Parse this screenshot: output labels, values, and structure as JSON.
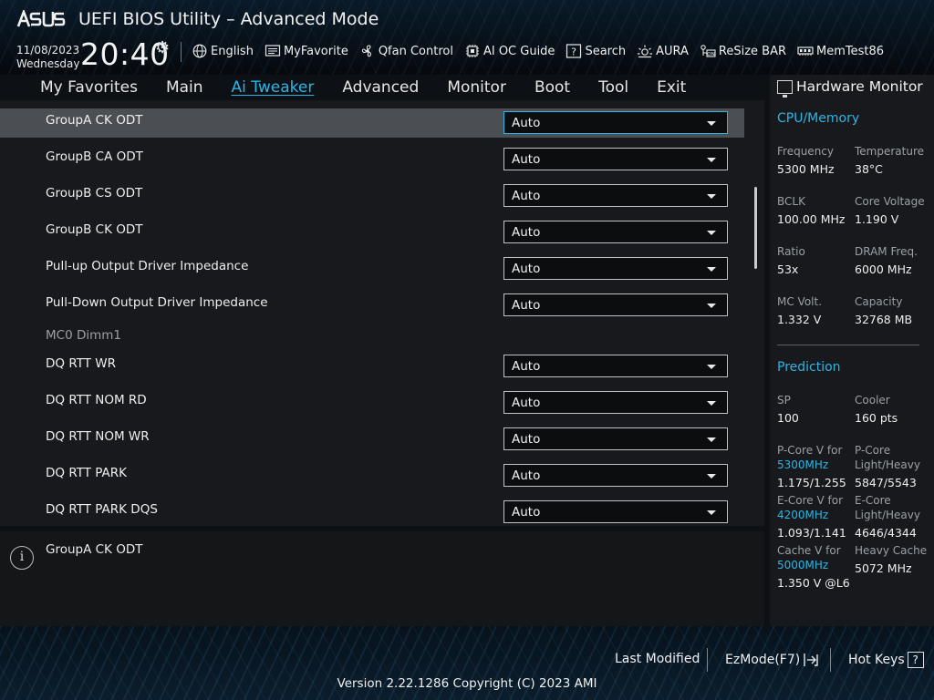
{
  "header": {
    "brand": "ASUS",
    "title": "UEFI BIOS Utility – Advanced Mode",
    "date": "11/08/2023",
    "day": "Wednesday",
    "time": "20:40",
    "toolbar": [
      {
        "label": "English",
        "icon": "globe-icon"
      },
      {
        "label": "MyFavorite",
        "icon": "favorite-icon"
      },
      {
        "label": "Qfan Control",
        "icon": "fan-icon"
      },
      {
        "label": "AI OC Guide",
        "icon": "ai-chip-icon"
      },
      {
        "label": "Search",
        "icon": "search-icon"
      },
      {
        "label": "AURA",
        "icon": "aura-icon"
      },
      {
        "label": "ReSize BAR",
        "icon": "resize-bar-icon"
      },
      {
        "label": "MemTest86",
        "icon": "memory-icon"
      }
    ]
  },
  "tabs": [
    {
      "label": "My Favorites",
      "active": false
    },
    {
      "label": "Main",
      "active": false
    },
    {
      "label": "Ai Tweaker",
      "active": true
    },
    {
      "label": "Advanced",
      "active": false
    },
    {
      "label": "Monitor",
      "active": false
    },
    {
      "label": "Boot",
      "active": false
    },
    {
      "label": "Tool",
      "active": false
    },
    {
      "label": "Exit",
      "active": false
    }
  ],
  "settings": {
    "rows": [
      {
        "label": "GroupA CK ODT",
        "value": "Auto",
        "selected": true
      },
      {
        "label": "GroupB CA ODT",
        "value": "Auto"
      },
      {
        "label": "GroupB CS ODT",
        "value": "Auto"
      },
      {
        "label": "GroupB CK ODT",
        "value": "Auto"
      },
      {
        "label": "Pull-up Output Driver Impedance",
        "value": "Auto"
      },
      {
        "label": "Pull-Down Output Driver Impedance",
        "value": "Auto"
      }
    ],
    "section_label": "MC0 Dimm1",
    "rows2": [
      {
        "label": "DQ RTT WR",
        "value": "Auto"
      },
      {
        "label": "DQ RTT NOM RD",
        "value": "Auto"
      },
      {
        "label": "DQ RTT NOM WR",
        "value": "Auto"
      },
      {
        "label": "DQ RTT PARK",
        "value": "Auto"
      },
      {
        "label": "DQ RTT PARK DQS",
        "value": "Auto"
      }
    ]
  },
  "help": {
    "text": "GroupA CK ODT"
  },
  "hardware_monitor": {
    "title": "Hardware Monitor",
    "cpu_memory": {
      "title": "CPU/Memory",
      "frequency_label": "Frequency",
      "frequency": "5300 MHz",
      "temperature_label": "Temperature",
      "temperature": "38°C",
      "bclk_label": "BCLK",
      "bclk": "100.00 MHz",
      "core_voltage_label": "Core Voltage",
      "core_voltage": "1.190 V",
      "ratio_label": "Ratio",
      "ratio": "53x",
      "dram_freq_label": "DRAM Freq.",
      "dram_freq": "6000 MHz",
      "mc_volt_label": "MC Volt.",
      "mc_volt": "1.332 V",
      "capacity_label": "Capacity",
      "capacity": "32768 MB"
    },
    "prediction": {
      "title": "Prediction",
      "sp_label": "SP",
      "sp": "100",
      "cooler_label": "Cooler",
      "cooler": "160 pts",
      "pcore_v_label": "P-Core V for",
      "pcore_v_freq": "5300MHz",
      "pcore_v": "1.175/1.255",
      "pcore_lh_label_1": "P-Core",
      "pcore_lh_label_2": "Light/Heavy",
      "pcore_lh": "5847/5543",
      "ecore_v_label": "E-Core V for",
      "ecore_v_freq": "4200MHz",
      "ecore_v": "1.093/1.141",
      "ecore_lh_label_1": "E-Core",
      "ecore_lh_label_2": "Light/Heavy",
      "ecore_lh": "4646/4344",
      "cache_v_label": "Cache V for",
      "cache_v_freq": "5000MHz",
      "cache_v": "1.350 V @L6",
      "heavy_cache_label": "Heavy Cache",
      "heavy_cache": "5072 MHz"
    }
  },
  "footer": {
    "last_modified": "Last Modified",
    "ezmode": "EzMode(F7)",
    "hotkeys": "Hot Keys",
    "hotkeys_key": "?",
    "version": "Version 2.22.1286 Copyright (C) 2023 AMI"
  },
  "colors": {
    "accent": "#2bb6e6",
    "panel": "#17191c",
    "selected_row": "#4b4f54"
  }
}
